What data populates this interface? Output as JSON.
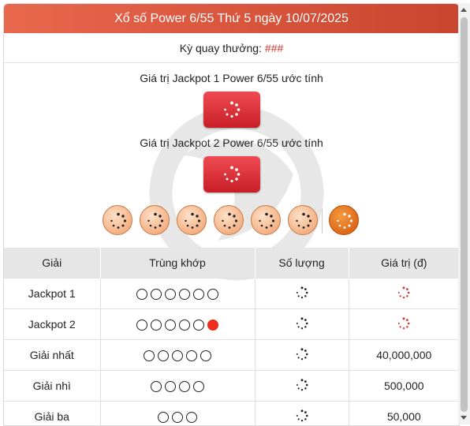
{
  "header": {
    "title": "Xổ số Power 6/55 Thứ 5 ngày 10/07/2025"
  },
  "draw": {
    "label": "Kỳ quay thưởng:",
    "value": "###"
  },
  "jackpot1": {
    "label": "Giá trị Jackpot 1 Power 6/55 ước tính"
  },
  "jackpot2": {
    "label": "Giá trị Jackpot 2 Power 6/55 ước tính"
  },
  "table": {
    "headers": [
      "Giải",
      "Trùng khớp",
      "Số lượng",
      "Giá trị (đ)"
    ],
    "rows": [
      {
        "prize": "Jackpot 1",
        "matches": 6,
        "power": false,
        "value": ""
      },
      {
        "prize": "Jackpot 2",
        "matches": 5,
        "power": true,
        "value": ""
      },
      {
        "prize": "Giải nhất",
        "matches": 5,
        "power": false,
        "value": "40,000,000"
      },
      {
        "prize": "Giải nhì",
        "matches": 4,
        "power": false,
        "value": "500,000"
      },
      {
        "prize": "Giải ba",
        "matches": 3,
        "power": false,
        "value": "50,000"
      }
    ]
  },
  "colors": {
    "header": "#d85a3f",
    "accent": "#d6332b",
    "ball": "#f6b88e",
    "power_ball": "#e0701f"
  }
}
